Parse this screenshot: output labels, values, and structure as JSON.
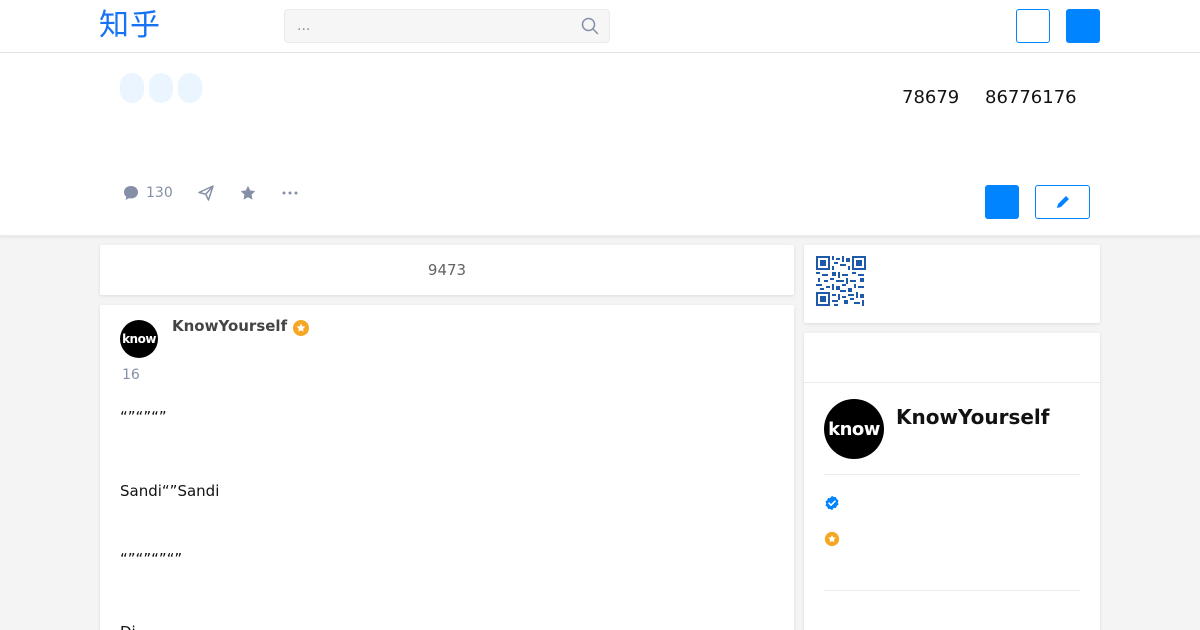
{
  "nav": {
    "logo": "知乎",
    "search_placeholder": "..."
  },
  "question": {
    "followers": "78679",
    "views": "86776176",
    "comment_count": "130"
  },
  "answers_count": "9473",
  "answer": {
    "author_name": "KnowYourself",
    "avatar_text": "know",
    "voteup_count": "16",
    "paragraphs": [
      "“”“”“”",
      "Sandi“”Sandi",
      "“”“”“”“”",
      "Di"
    ]
  },
  "sidebar": {
    "author_name": "KnowYourself",
    "avatar_text": "know"
  },
  "colors": {
    "brand": "#1772f6",
    "primary": "#0084ff",
    "muted": "#8590a6",
    "badge_orange": "#f5a623",
    "verified_blue": "#0084ff"
  },
  "icons": [
    "search-icon",
    "comment-icon",
    "share-icon",
    "star-icon",
    "more-icon",
    "pencil-icon",
    "qr-code-icon",
    "verified-icon",
    "badge-icon"
  ]
}
